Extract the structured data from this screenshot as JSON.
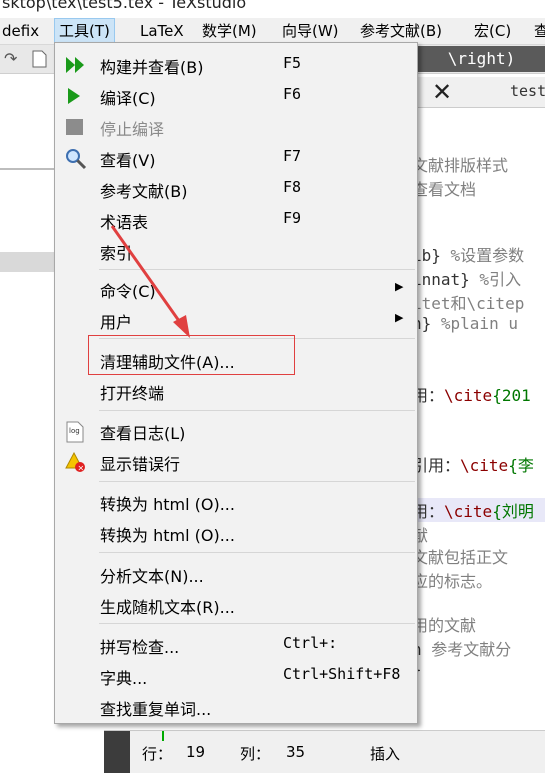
{
  "window": {
    "title": "sktop\\tex\\test5.tex - TeXstudio"
  },
  "menubar": {
    "items": [
      "defix",
      "工具(T)",
      "LaTeX",
      "数学(M)",
      "向导(W)",
      "参考文献(B)",
      "宏(C)",
      "查"
    ]
  },
  "toolbar": {
    "right_button": "\\right)"
  },
  "tab": {
    "close": "✕",
    "filename": "test"
  },
  "tools_menu": {
    "items": [
      {
        "label": "构建并查看(B)",
        "shortcut": "F5",
        "icon": "double-play-icon"
      },
      {
        "label": "编译(C)",
        "shortcut": "F6",
        "icon": "play-icon"
      },
      {
        "label": "停止编译",
        "shortcut": "",
        "icon": "stop-icon",
        "disabled": true
      },
      {
        "label": "查看(V)",
        "shortcut": "F7",
        "icon": "magnifier-icon"
      },
      {
        "label": "参考文献(B)",
        "shortcut": "F8"
      },
      {
        "label": "术语表",
        "shortcut": "F9"
      },
      {
        "label": "索引",
        "shortcut": ""
      },
      {
        "label": "命令(C)",
        "submenu": true
      },
      {
        "label": "用户",
        "submenu": true
      },
      {
        "label": "清理辅助文件(A)..."
      },
      {
        "label": "打开终端"
      },
      {
        "label": "查看日志(L)",
        "icon": "log-icon"
      },
      {
        "label": "显示错误行",
        "icon": "error-icon"
      },
      {
        "label": "转换为 html (O)..."
      },
      {
        "label": "转换为 html (O)..."
      },
      {
        "label": "分析文本(N)..."
      },
      {
        "label": "生成随机文本(R)..."
      },
      {
        "label": "拼写检查...",
        "shortcut": "Ctrl+:"
      },
      {
        "label": "字典...",
        "shortcut": "Ctrl+Shift+F8"
      },
      {
        "label": "查找重复单词..."
      }
    ]
  },
  "editor": {
    "l1": "文献排版样式",
    "l2": "查看文档",
    "l3a": "ib}",
    "l3b": " %设置参数",
    "l4a": "innat}",
    "l4b": " %引入",
    "l5": "itet和\\citep",
    "l6a": "n}",
    "l6b": " %plain u",
    "l7a": "用：",
    "l7b": "\\cite",
    "l7c": "{201",
    "l8a": "引用：",
    "l8b": "\\cite",
    "l8c": "{李",
    "l9a": "用：",
    "l9b": "\\cite",
    "l9c": "{刘明",
    "l10": "献",
    "l11": "文献包括正文",
    "l12": "应的标志。",
    "l13": "用的文献",
    "l14a": "n",
    "l14b": "  参考文献分",
    "l15": "}"
  },
  "status": {
    "row_label": "行：",
    "row_value": "19",
    "col_label": "列：",
    "col_value": "35",
    "mode": "插入"
  }
}
